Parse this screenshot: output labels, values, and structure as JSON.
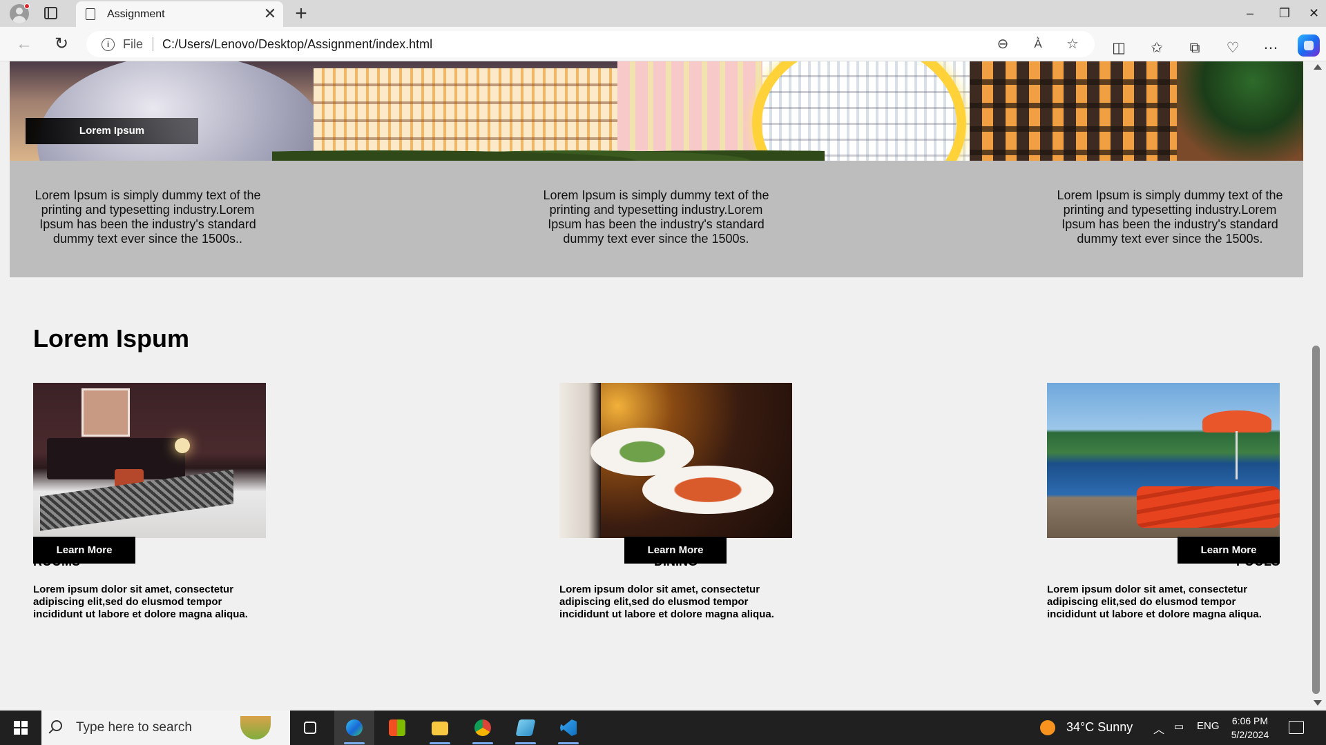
{
  "browser": {
    "tab_title": "Assignment",
    "address_prefix": "File",
    "url": "C:/Users/Lenovo/Desktop/Assignment/index.html"
  },
  "hero": {
    "label": "Lorem Ipsum"
  },
  "band": {
    "texts": [
      "Lorem Ipsum is simply dummy text of the printing and typesetting industry.Lorem Ipsum has been the industry's standard dummy text ever since the 1500s..",
      "Lorem Ipsum is simply dummy text of the printing and typesetting industry.Lorem Ipsum has been the industry's standard dummy text ever since the 1500s.",
      "Lorem Ipsum is simply dummy text of the printing and typesetting industry.Lorem Ipsum has been the industry's standard dummy text ever since the 1500s."
    ]
  },
  "section": {
    "title": "Lorem Ispum",
    "cards": [
      {
        "title": "ROOMS",
        "desc": "Lorem ipsum dolor sit amet, consectetur adipiscing elit,sed do elusmod tempor incididunt ut labore et dolore magna aliqua.",
        "button": "Learn More"
      },
      {
        "title": "DINING",
        "desc": "Lorem ipsum dolor sit amet, consectetur adipiscing elit,sed do elusmod tempor incididunt ut labore et dolore magna aliqua.",
        "button": "Learn More"
      },
      {
        "title": "POOLS",
        "desc": "Lorem ipsum dolor sit amet, consectetur adipiscing elit,sed do elusmod tempor incididunt ut labore et dolore magna aliqua.",
        "button": "Learn More"
      }
    ]
  },
  "taskbar": {
    "search_placeholder": "Type here to search",
    "weather": "34°C  Sunny",
    "language": "ENG",
    "time": "6:06 PM",
    "date": "5/2/2024"
  },
  "icons": [
    "profile-icon",
    "tab-actions-icon",
    "page-icon",
    "close-icon",
    "plus-icon",
    "minimize-icon",
    "restore-icon",
    "back-icon",
    "refresh-icon",
    "info-icon",
    "zoom-out-icon",
    "read-aloud-icon",
    "favorite-star-icon",
    "split-screen-icon",
    "favorites-icon",
    "collections-icon",
    "browser-essentials-icon",
    "more-icon",
    "copilot-icon",
    "windows-start-icon",
    "search-icon",
    "task-view-icon",
    "edge-icon",
    "store-icon",
    "file-explorer-icon",
    "chrome-icon",
    "notepad-icon",
    "vscode-icon",
    "weather-icon",
    "chevron-up-icon",
    "battery-icon",
    "notification-icon"
  ],
  "colors": {
    "band_bg": "#bdbdbd",
    "button_bg": "#000000",
    "page_bg": "#f0f0f0"
  }
}
